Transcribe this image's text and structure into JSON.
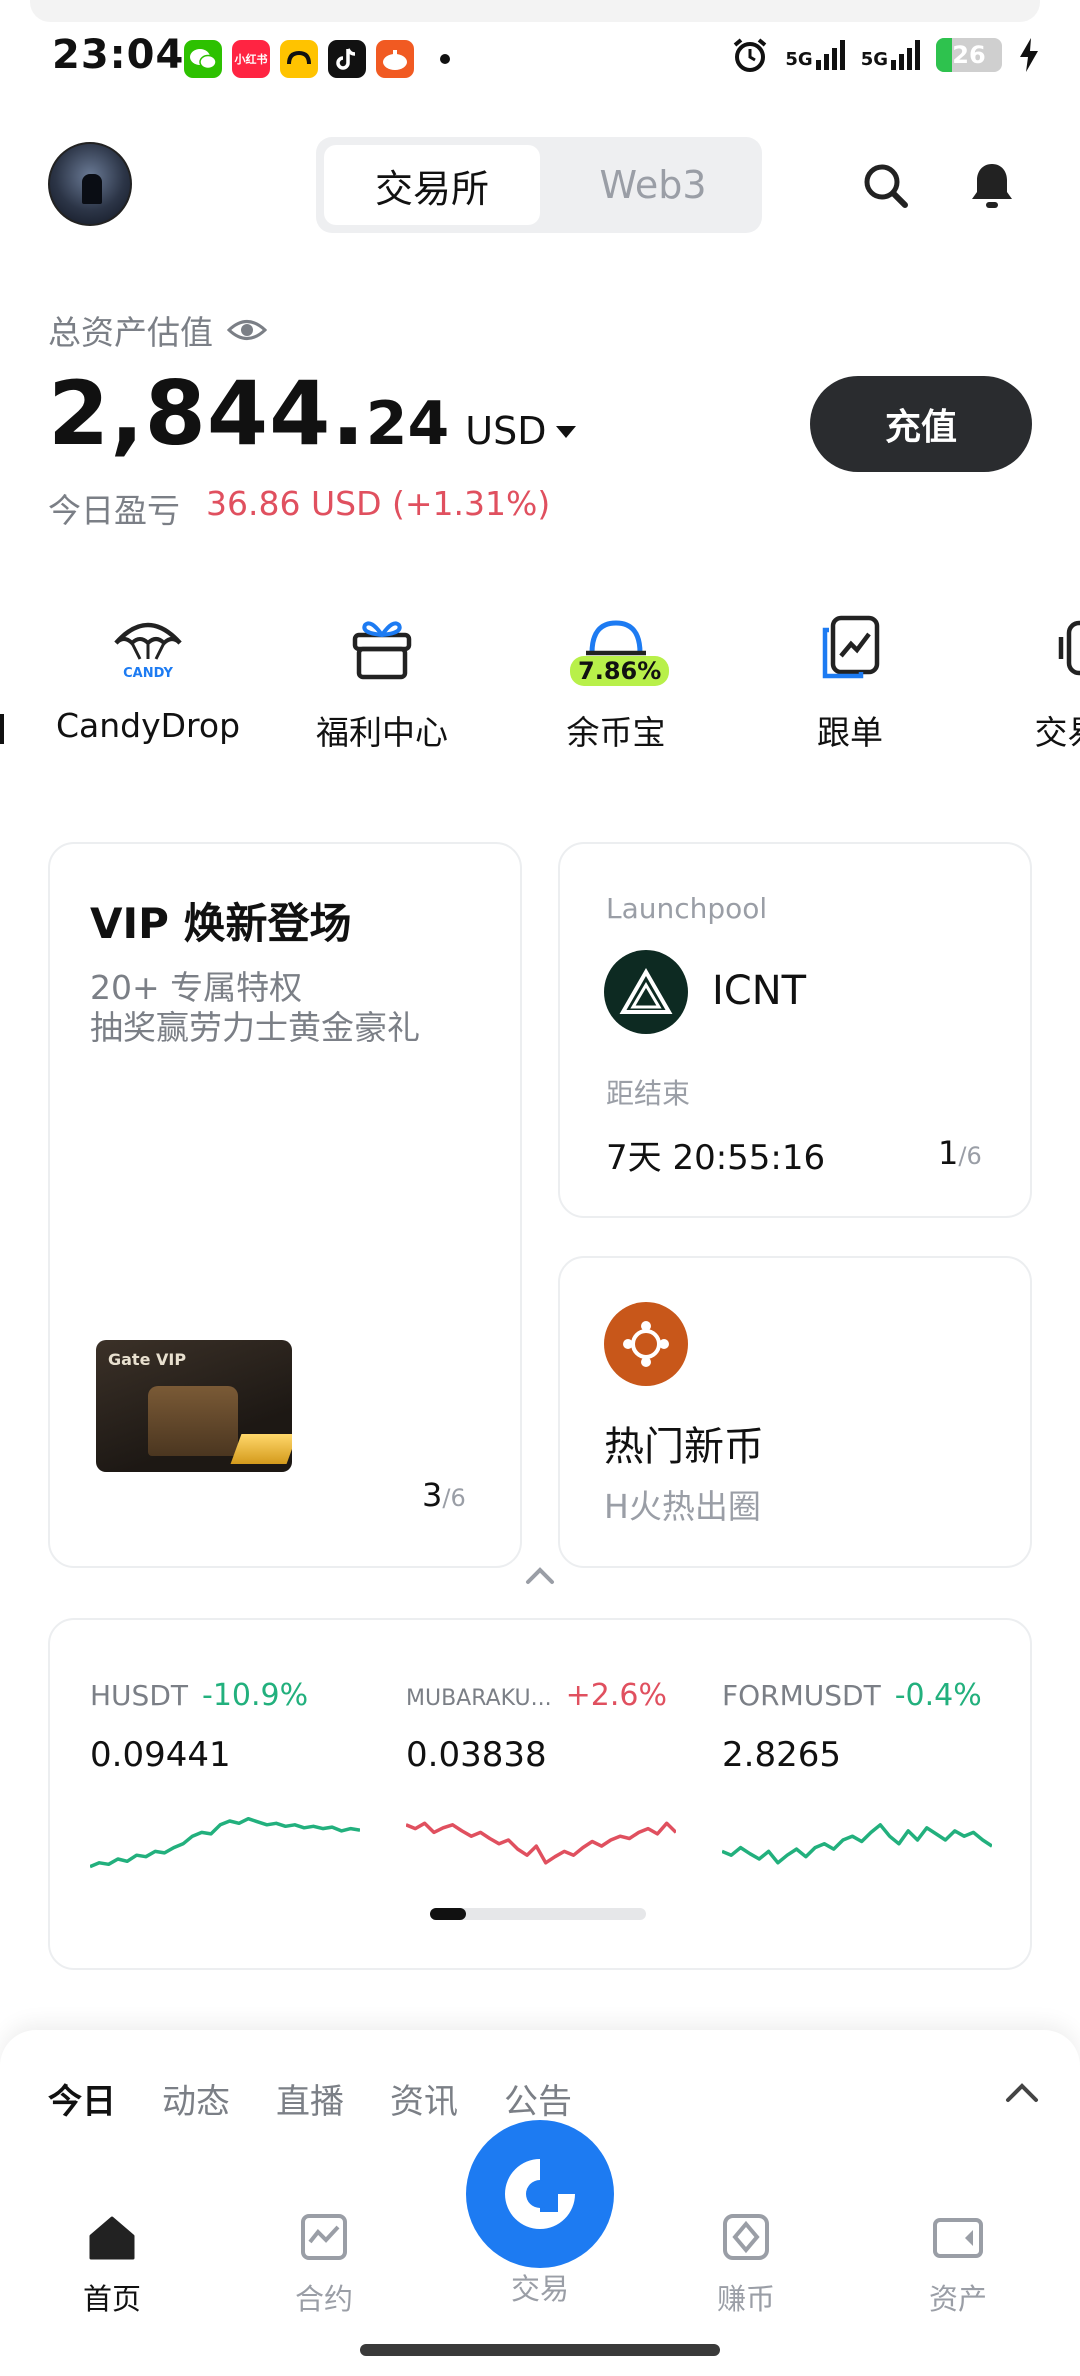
{
  "status_bar": {
    "time": "23:04",
    "network_1": "5G",
    "network_2": "5G",
    "battery": "26"
  },
  "header": {
    "tab_exchange": "交易所",
    "tab_web3": "Web3"
  },
  "assets": {
    "label": "总资产估值",
    "amount_int": "2,844.",
    "amount_dec": "24",
    "currency": "USD",
    "pnl_label": "今日盈亏",
    "pnl_value": "36.86 USD",
    "pnl_percent": "(+1.31%)",
    "deposit_label": "充值"
  },
  "shortcuts": [
    {
      "label": "CandyDrop",
      "icon": "candy-parachute-icon",
      "icon_text": "CANDY"
    },
    {
      "label": "福利中心",
      "icon": "gift-icon"
    },
    {
      "label": "余币宝",
      "icon": "piggy-icon",
      "badge": "7.86%"
    },
    {
      "label": "跟单",
      "icon": "copy-trade-icon"
    },
    {
      "label": "交易机",
      "icon": "bot-icon"
    }
  ],
  "cards": {
    "vip": {
      "title": "VIP 焕新登场",
      "line1": "20+ 专属特权",
      "line2": "抽奖赢劳力士黄金豪礼",
      "brand": "Gate VIP",
      "page_current": "3",
      "page_total": "/6"
    },
    "launchpool": {
      "label": "Launchpool",
      "token": "ICNT",
      "countdown_label": "距结束",
      "countdown": "7天 20:55:16",
      "page_current": "1",
      "page_total": "/6"
    },
    "hot": {
      "title": "热门新币",
      "subtitle": "H火热出圈"
    }
  },
  "tickers": [
    {
      "symbol": "HUSDT",
      "change": "-10.9%",
      "price": "0.09441",
      "direction": "up",
      "color": "#22b07d",
      "spark": [
        0.15,
        0.2,
        0.18,
        0.25,
        0.22,
        0.3,
        0.28,
        0.35,
        0.33,
        0.4,
        0.45,
        0.55,
        0.6,
        0.58,
        0.7,
        0.75,
        0.72,
        0.78,
        0.74,
        0.7,
        0.72,
        0.68,
        0.7,
        0.66,
        0.68,
        0.65,
        0.67,
        0.62,
        0.65,
        0.63
      ]
    },
    {
      "symbol": "MUBARAKU...",
      "change": "+2.6%",
      "price": "0.03838",
      "direction": "down",
      "color": "#e0505f",
      "spark": [
        0.7,
        0.65,
        0.72,
        0.6,
        0.66,
        0.7,
        0.62,
        0.55,
        0.6,
        0.52,
        0.45,
        0.5,
        0.38,
        0.3,
        0.42,
        0.2,
        0.28,
        0.35,
        0.3,
        0.4,
        0.48,
        0.42,
        0.5,
        0.55,
        0.52,
        0.6,
        0.65,
        0.58,
        0.72,
        0.6
      ]
    },
    {
      "symbol": "FORMUSDT",
      "change": "-0.4%",
      "price": "2.8265",
      "direction": "up",
      "color": "#22b07d",
      "spark": [
        0.35,
        0.3,
        0.4,
        0.32,
        0.25,
        0.35,
        0.2,
        0.3,
        0.38,
        0.28,
        0.4,
        0.45,
        0.38,
        0.5,
        0.55,
        0.48,
        0.6,
        0.7,
        0.55,
        0.45,
        0.62,
        0.5,
        0.66,
        0.58,
        0.5,
        0.62,
        0.55,
        0.6,
        0.5,
        0.42
      ]
    }
  ],
  "sheet": {
    "tabs": [
      "今日",
      "动态",
      "直播",
      "资讯",
      "公告"
    ]
  },
  "bottom_nav": [
    {
      "label": "首页",
      "icon": "home-icon"
    },
    {
      "label": "合约",
      "icon": "futures-chart-icon"
    },
    {
      "label": "交易",
      "icon": "trade-fab-icon"
    },
    {
      "label": "赚币",
      "icon": "earn-icon"
    },
    {
      "label": "资产",
      "icon": "wallet-icon"
    }
  ]
}
